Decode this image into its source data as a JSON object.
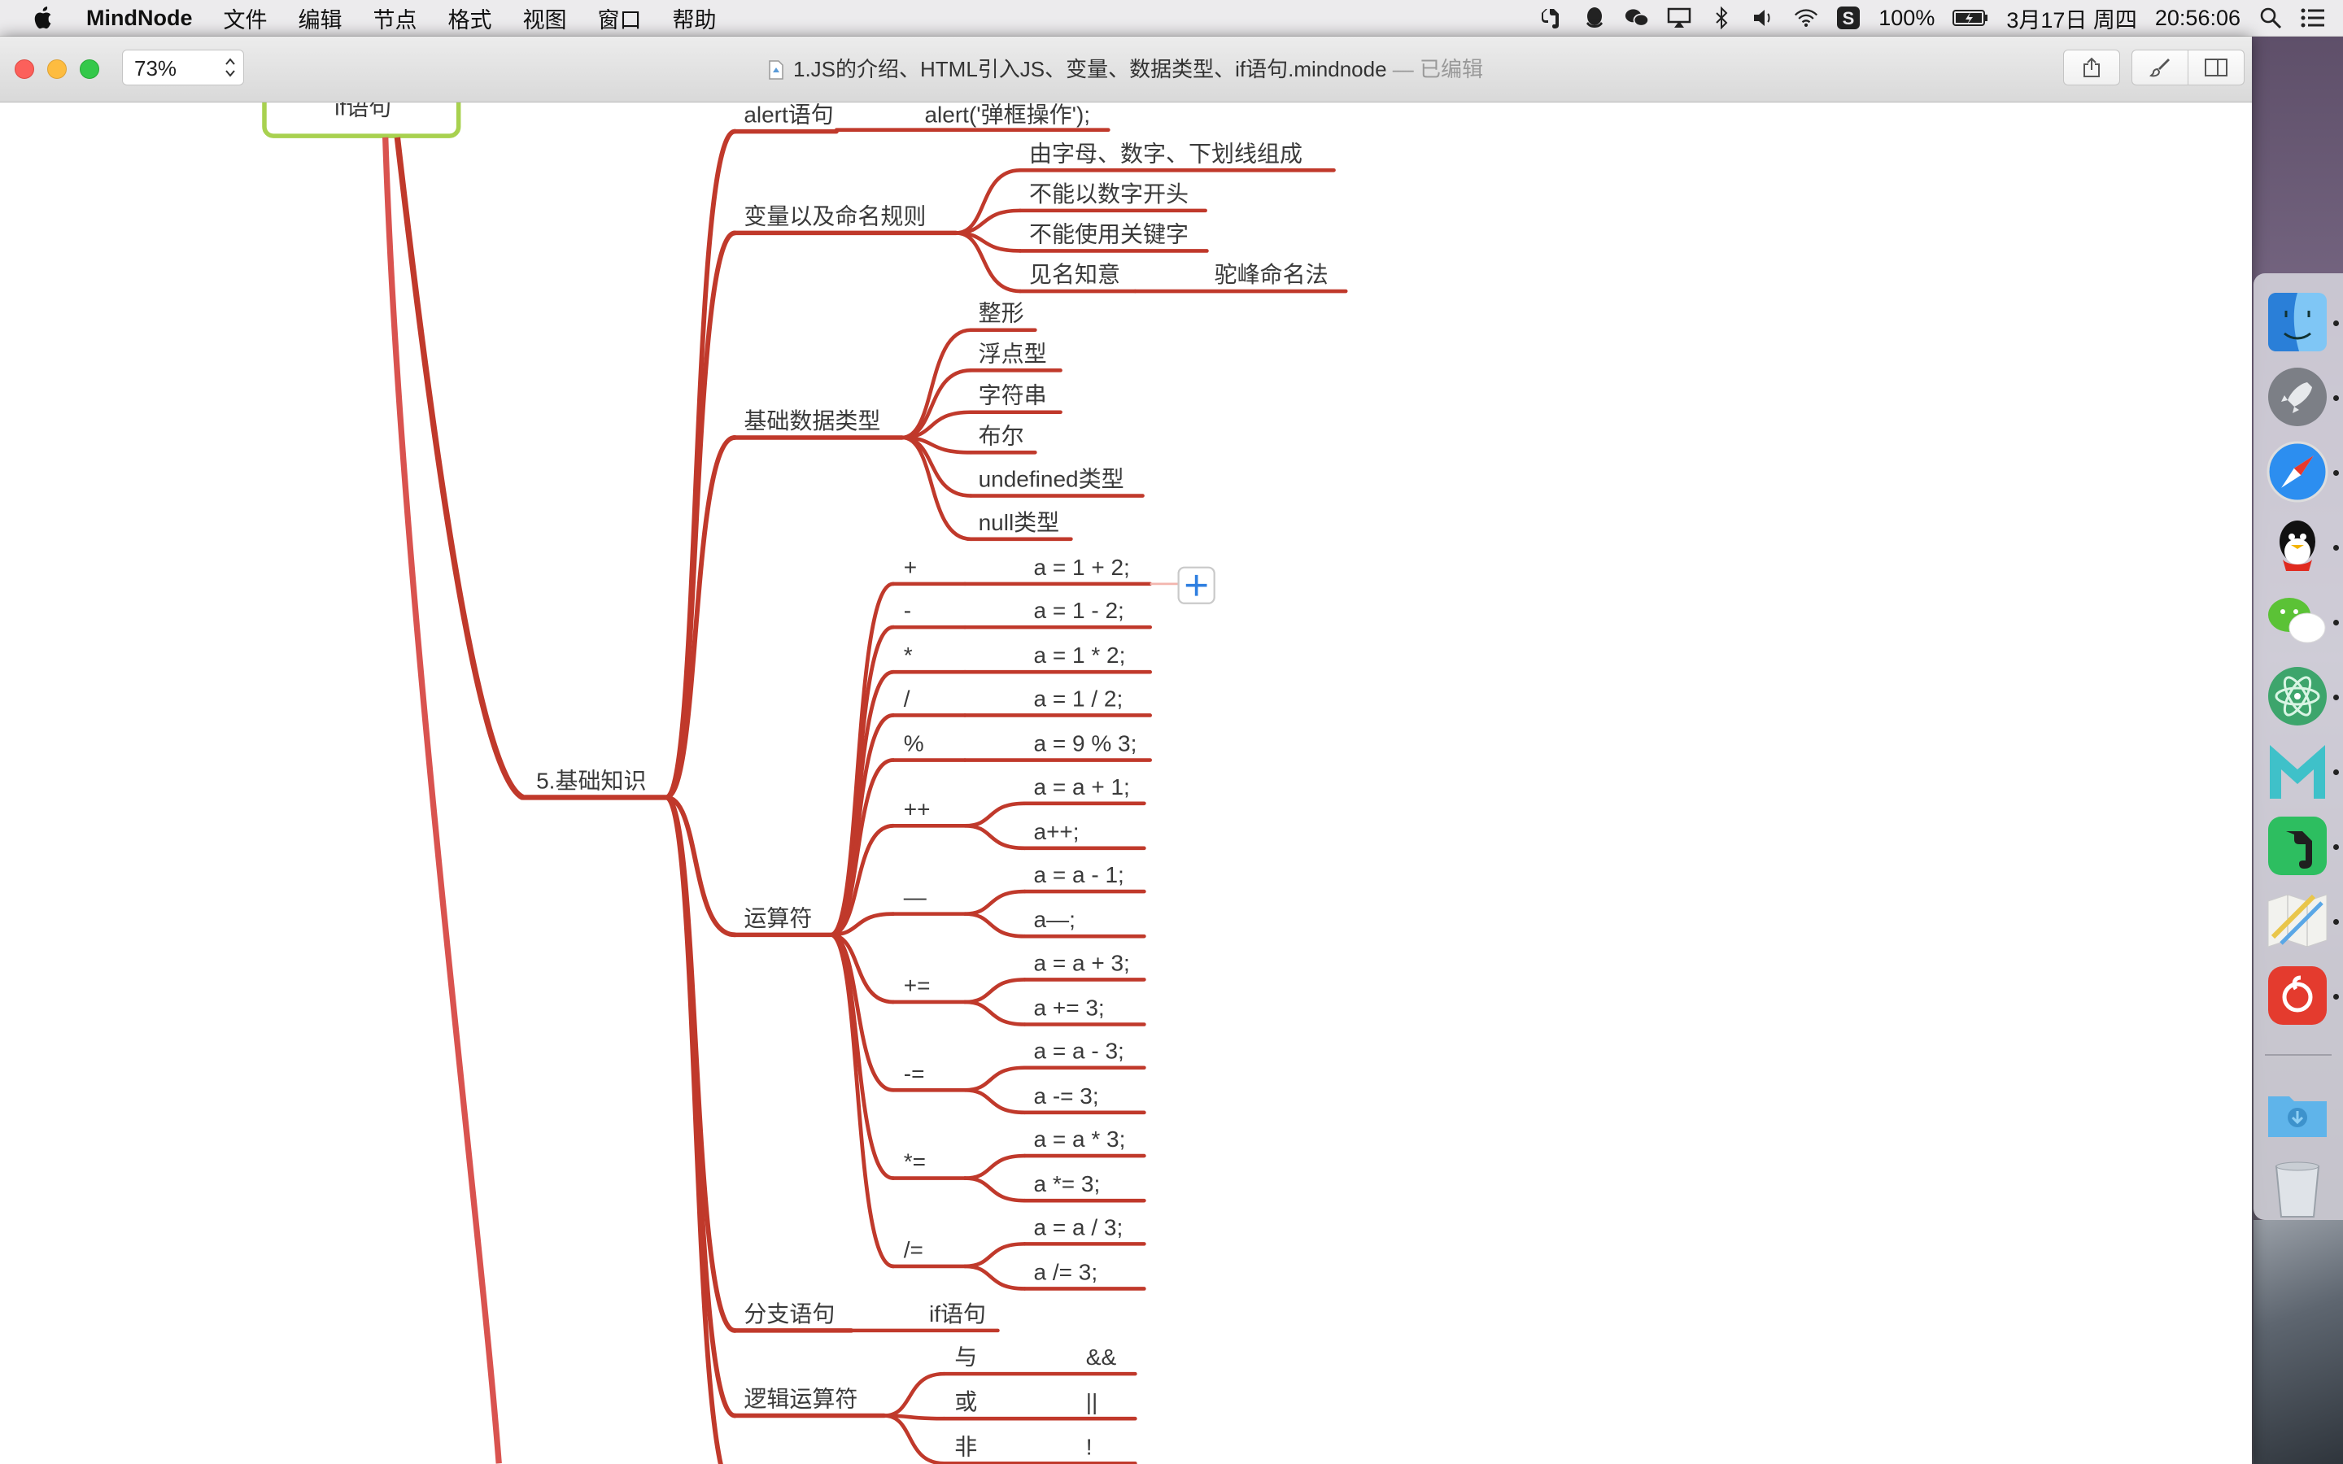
{
  "menubar": {
    "app_name": "MindNode",
    "menus": [
      "文件",
      "编辑",
      "节点",
      "格式",
      "视图",
      "窗口",
      "帮助"
    ],
    "battery": "100%",
    "date": "3月17日 周四",
    "time": "20:56:06"
  },
  "window": {
    "zoom": "73%",
    "title": "1.JS的介绍、HTML引入JS、变量、数据类型、if语句.mindnode",
    "status": "— 已编辑"
  },
  "mindmap": {
    "colors": {
      "branch": "#c0392b",
      "root_border": "#a8d14f"
    },
    "top_node": "if语句",
    "main": "5.基础知识",
    "alert": {
      "label": "alert语句",
      "child": "alert('弹框操作');"
    },
    "variables": {
      "label": "变量以及命名规则",
      "children": [
        "由字母、数字、下划线组成",
        "不能以数字开头",
        "不能使用关键字",
        "见名知意"
      ],
      "sub": "驼峰命名法"
    },
    "types": {
      "label": "基础数据类型",
      "children": [
        "整形",
        "浮点型",
        "字符串",
        "布尔",
        "undefined类型",
        "null类型"
      ]
    },
    "operators": {
      "label": "运算符",
      "items": [
        {
          "op": "+",
          "ex": [
            "a = 1 + 2;"
          ]
        },
        {
          "op": "-",
          "ex": [
            "a = 1 - 2;"
          ]
        },
        {
          "op": "*",
          "ex": [
            "a = 1 * 2;"
          ]
        },
        {
          "op": "/",
          "ex": [
            "a = 1 / 2;"
          ]
        },
        {
          "op": "%",
          "ex": [
            "a = 9 % 3;"
          ]
        },
        {
          "op": "++",
          "ex": [
            "a = a + 1;",
            "a++;"
          ]
        },
        {
          "op": "—",
          "ex": [
            "a = a - 1;",
            "a—;"
          ]
        },
        {
          "op": "+=",
          "ex": [
            "a = a + 3;",
            "a += 3;"
          ]
        },
        {
          "op": "-=",
          "ex": [
            "a = a - 3;",
            "a -= 3;"
          ]
        },
        {
          "op": "*=",
          "ex": [
            "a = a * 3;",
            "a *= 3;"
          ]
        },
        {
          "op": "/=",
          "ex": [
            "a = a / 3;",
            "a /= 3;"
          ]
        }
      ]
    },
    "branch_stmt": {
      "label": "分支语句",
      "child": "if语句"
    },
    "logic": {
      "label": "逻辑运算符",
      "items": [
        {
          "name": "与",
          "sym": "&&"
        },
        {
          "name": "或",
          "sym": "||"
        },
        {
          "name": "非",
          "sym": "!"
        }
      ]
    }
  },
  "dock": [
    "finder-icon",
    "launchpad-icon",
    "safari-icon",
    "qq-icon",
    "wechat-icon",
    "atom-icon",
    "mindnode-icon",
    "evernote-icon",
    "maps-icon",
    "netease-music-icon",
    "downloads-folder-icon",
    "trash-icon"
  ]
}
